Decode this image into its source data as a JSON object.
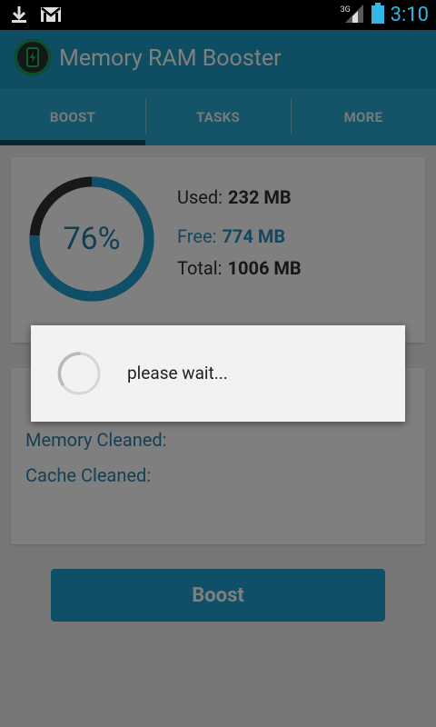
{
  "status_bar": {
    "time": "3:10",
    "network_label": "3G",
    "icons": [
      "download-icon",
      "gmail-icon",
      "signal-icon",
      "battery-icon"
    ]
  },
  "app": {
    "title": "Memory RAM Booster"
  },
  "tabs": [
    {
      "label": "BOOST",
      "active": true
    },
    {
      "label": "TASKS",
      "active": false
    },
    {
      "label": "MORE",
      "active": false
    }
  ],
  "memory": {
    "percent_label": "76%",
    "used_label": "Used:",
    "used_value": "232 MB",
    "free_label": "Free:",
    "free_value": "774 MB",
    "total_label": "Total:",
    "total_value": "1006 MB",
    "ring_fill_fraction": 0.76
  },
  "clean_results": {
    "first_line": "",
    "memory_cleaned_label": "Memory Cleaned:",
    "cache_cleaned_label": "Cache Cleaned:"
  },
  "boost_button": {
    "label": "Boost"
  },
  "dialog": {
    "message": "please wait..."
  },
  "colors": {
    "action_bar": "#1e9bc7",
    "tab_bar": "#2aa6d1",
    "ring_fill": "#1f9ed0",
    "ring_track": "#2c3035",
    "accent_text": "#1f7fab",
    "status_time": "#33b5e5"
  }
}
